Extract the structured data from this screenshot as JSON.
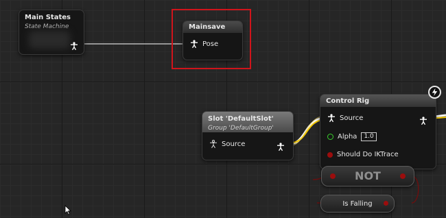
{
  "nodes": {
    "main_states": {
      "title": "Main States",
      "subtitle": "State Machine"
    },
    "mainsave": {
      "title": "Mainsave",
      "pin_pose": "Pose"
    },
    "slot": {
      "title": "Slot 'DefaultSlot'",
      "subtitle": "Group 'DefaultGroup'",
      "pin_source": "Source"
    },
    "control_rig": {
      "title": "Control Rig",
      "pin_source": "Source",
      "pin_alpha": "Alpha",
      "alpha_value": "1.0",
      "pin_ik": "Should Do IKTrace"
    },
    "not": {
      "label": "NOT"
    },
    "is_falling": {
      "label": "Is Falling"
    }
  },
  "colors": {
    "selection": "#d1141b",
    "pose_wire": "#e8e8e8",
    "exec_wire": "#f2c700",
    "bool_pin": "#9b0d0d",
    "float_pin": "#39d12c"
  },
  "icons": [
    "pose-pin-icon",
    "lightning-icon",
    "mouse-cursor-icon"
  ]
}
